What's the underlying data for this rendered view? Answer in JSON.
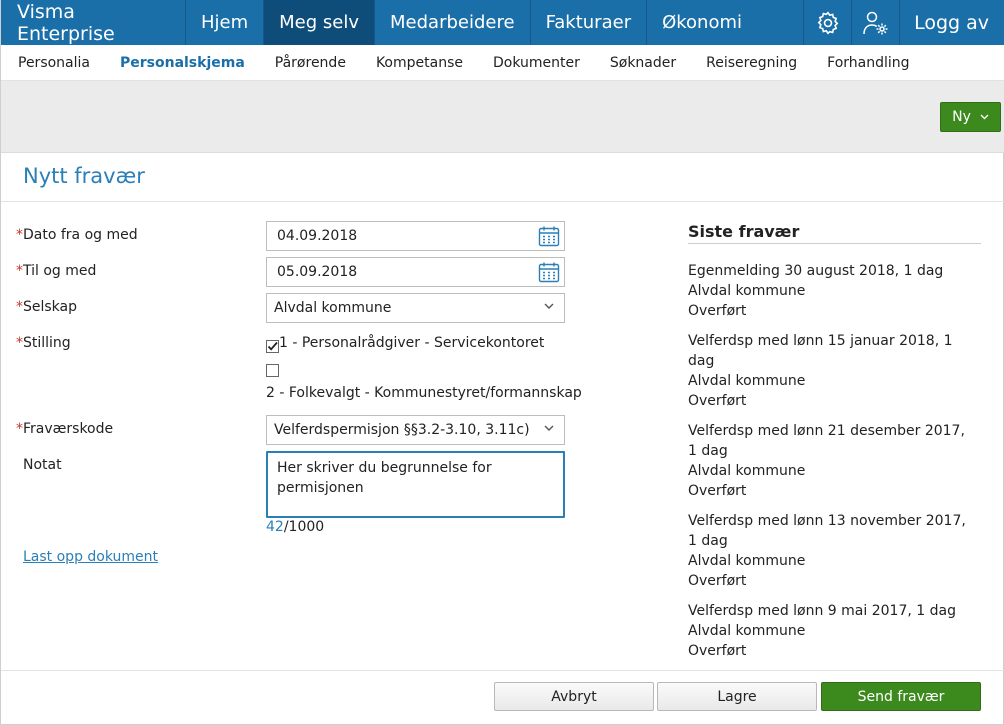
{
  "topnav": {
    "brand": "Visma Enterprise",
    "items": [
      "Hjem",
      "Meg selv",
      "Medarbeidere",
      "Fakturaer",
      "Økonomi"
    ],
    "active": "Meg selv",
    "settings_icon": "gear-icon",
    "user_icon": "user-settings-icon",
    "logout_label": "Logg av"
  },
  "subnav": {
    "items": [
      "Personalia",
      "Personalskjema",
      "Pårørende",
      "Kompetanse",
      "Dokumenter",
      "Søknader",
      "Reiseregning",
      "Forhandling"
    ],
    "active": "Personalskjema"
  },
  "toolbar": {
    "new_label": "Ny"
  },
  "page": {
    "title": "Nytt fravær"
  },
  "form": {
    "required_marker": "*",
    "date_from_label": "Dato fra og med",
    "date_from_value": "04.09.2018",
    "date_to_label": "Til og med",
    "date_to_value": "05.09.2018",
    "company_label": "Selskap",
    "company_value": "Alvdal kommune",
    "position_label": "Stilling",
    "positions": [
      {
        "text": "1 - Personalrådgiver - Servicekontoret",
        "checked": true
      },
      {
        "text": "2 - Folkevalgt - Kommunestyret/formannskap",
        "checked": false
      }
    ],
    "absence_code_label": "Fraværskode",
    "absence_code_value": "Velferdspermisjon §§3.2-3.10, 3.11c)",
    "note_label": "Notat",
    "note_value": "Her skriver du begrunnelse for permisjonen",
    "char_count": "42",
    "char_max": "/1000",
    "upload_label": "Last opp dokument"
  },
  "recent": {
    "title": "Siste fravær",
    "items": [
      {
        "desc": "Egenmelding 30 august 2018, 1 dag",
        "company": "Alvdal kommune",
        "status": "Overført"
      },
      {
        "desc": "Velferdsp med lønn 15 januar 2018, 1 dag",
        "company": "Alvdal kommune",
        "status": "Overført"
      },
      {
        "desc": "Velferdsp med lønn 21 desember 2017, 1 dag",
        "company": "Alvdal kommune",
        "status": "Overført"
      },
      {
        "desc": "Velferdsp med lønn 13 november 2017, 1 dag",
        "company": "Alvdal kommune",
        "status": "Overført"
      },
      {
        "desc": "Velferdsp med lønn 9 mai 2017, 1 dag",
        "company": "Alvdal kommune",
        "status": "Overført"
      }
    ]
  },
  "footer": {
    "cancel_label": "Avbryt",
    "save_label": "Lagre",
    "submit_label": "Send fravær"
  },
  "colors": {
    "nav_blue": "#1b6fa8",
    "nav_active": "#0e4d7a",
    "accent_blue": "#2b7fb8",
    "primary_green": "#3c8a1e",
    "required_red": "#c0392b"
  }
}
